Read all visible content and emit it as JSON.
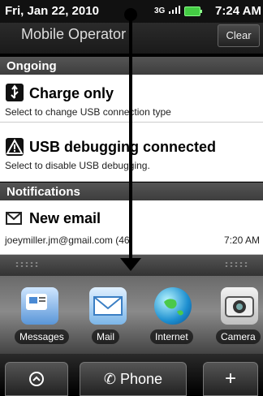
{
  "status_bar": {
    "date": "Fri, Jan 22, 2010",
    "network": "3G",
    "time": "7:24 AM"
  },
  "operator": {
    "name": "Mobile Operator",
    "clear_label": "Clear"
  },
  "sections": {
    "ongoing": "Ongoing",
    "notifications": "Notifications"
  },
  "ongoing_items": [
    {
      "title": "Charge only",
      "subtitle": "Select to change USB connection type",
      "icon": "usb-icon"
    },
    {
      "title": "USB debugging connected",
      "subtitle": "Select to disable USB debugging.",
      "icon": "warning-icon"
    }
  ],
  "notification_items": [
    {
      "title": "New email",
      "subtitle": "joeymiller.jm@gmail.com (46)",
      "time": "7:20 AM",
      "icon": "email-icon"
    }
  ],
  "apps": [
    {
      "label": "Messages",
      "icon": "messages-icon"
    },
    {
      "label": "Mail",
      "icon": "mail-icon"
    },
    {
      "label": "Internet",
      "icon": "globe-icon"
    },
    {
      "label": "Camera",
      "icon": "camera-icon"
    }
  ],
  "dock": {
    "phone_label": "Phone",
    "plus_label": "+"
  }
}
